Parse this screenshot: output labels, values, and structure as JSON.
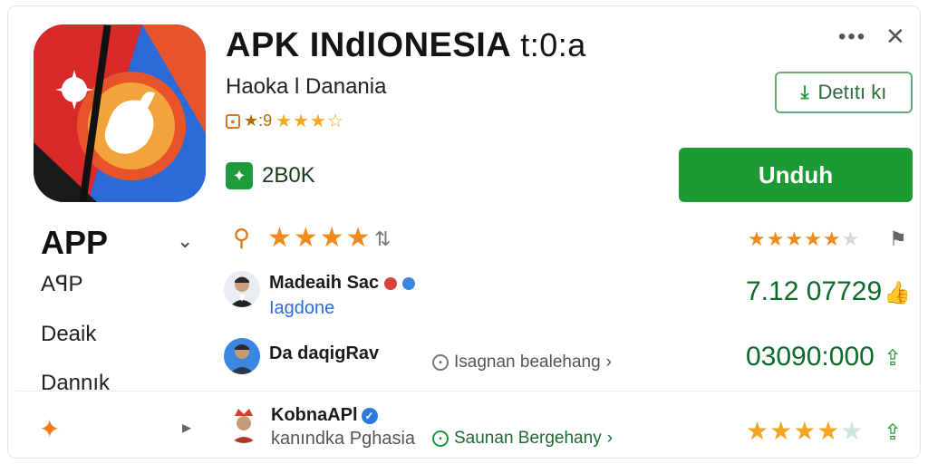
{
  "header": {
    "title": "APK INdIONESIA",
    "title_suffix": "t:0:a",
    "developer": "Haoka l Danania",
    "rating_text": "★:9",
    "rating_stars": "★★★☆",
    "download_count": "2B0K"
  },
  "controls": {
    "more": "•••",
    "close": "✕",
    "detail_label": "Detıtı kı",
    "install_label": "Unduh"
  },
  "menu": {
    "title": "APP",
    "items": [
      "AꟼP",
      "Deaik",
      "Dannık"
    ]
  },
  "summary": {
    "stars": "★★★★",
    "right_stars_filled": "★★★★★",
    "right_stars_dim": "★"
  },
  "reviews": [
    {
      "name": "Madeaih Sac",
      "sub": "Iagdone",
      "count": "7.12 07729"
    },
    {
      "name": "Da daqigRav",
      "sub": "",
      "link": "Isagnan bealehang",
      "count": "03090:000"
    },
    {
      "name": "KobnaAPl",
      "sub": "kanındka Pghasia",
      "link": "Saunan Bergehany"
    }
  ],
  "bottom": {
    "stars_filled": "★★★★",
    "stars_dim": "★"
  },
  "colors": {
    "install_green": "#1e9a34",
    "accent_orange": "#f08a1c",
    "count_green": "#0d6b2a",
    "link_blue": "#2a6bd9"
  },
  "icons": {
    "download": "download-icon",
    "more": "more-icon",
    "close": "close-icon",
    "verified": "verified-icon"
  }
}
